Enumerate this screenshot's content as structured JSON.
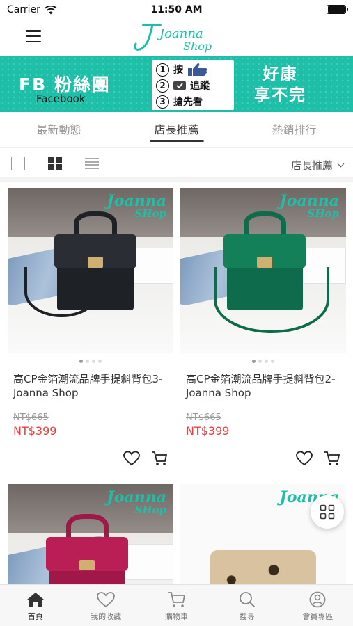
{
  "status_bar": {
    "carrier": "Carrier",
    "time": "11:50 AM"
  },
  "header": {
    "logo_line1": "Joanna",
    "logo_line2": "Shop"
  },
  "banner": {
    "left_title": "FB 粉絲團",
    "left_sub": "Facebook",
    "steps": [
      {
        "num": "1",
        "text": "按"
      },
      {
        "num": "2",
        "text": "追蹤"
      },
      {
        "num": "3",
        "text": "搶先看"
      }
    ],
    "right_line1": "好康",
    "right_line2": "享不完"
  },
  "tabs": [
    {
      "label": "最新動態",
      "active": false
    },
    {
      "label": "店長推薦",
      "active": true
    },
    {
      "label": "熱銷排行",
      "active": false
    }
  ],
  "sort": {
    "selected": "店長推薦"
  },
  "watermark": {
    "big": "Joanna",
    "small": "SHop"
  },
  "products": [
    {
      "title": "高CP金箔潮流品牌手提斜背包3-Joanna Shop",
      "price_old": "NT$665",
      "price_new": "NT$399",
      "bag_color": "#1e2126"
    },
    {
      "title": "高CP金箔潮流品牌手提斜背包2-Joanna Shop",
      "price_old": "NT$665",
      "price_new": "NT$399",
      "bag_color": "#0e6b4c"
    },
    {
      "title": "",
      "price_old": "",
      "price_new": "",
      "bag_color": "#a01848"
    },
    {
      "title": "",
      "price_old": "",
      "price_new": "",
      "bag_color": "#6b4a2a"
    }
  ],
  "bottom_nav": [
    {
      "label": "首頁",
      "icon": "home-icon",
      "active": true
    },
    {
      "label": "我的收藏",
      "icon": "heart-icon",
      "active": false
    },
    {
      "label": "購物車",
      "icon": "cart-icon",
      "active": false
    },
    {
      "label": "搜尋",
      "icon": "search-icon",
      "active": false
    },
    {
      "label": "會員專區",
      "icon": "user-icon",
      "active": false
    }
  ],
  "colors": {
    "brand": "#1dbfa8",
    "price": "#f23c3c"
  }
}
